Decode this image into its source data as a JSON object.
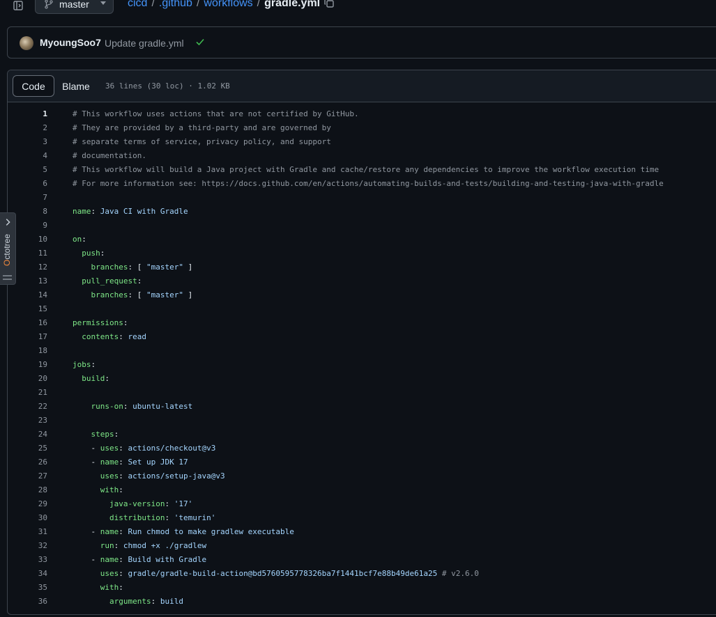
{
  "topbar": {
    "branch": "master",
    "breadcrumb": {
      "repo": "cicd",
      "dir1": ".github",
      "dir2": "workflows",
      "file": "gradle.yml",
      "separator": "/"
    }
  },
  "commit": {
    "author": "MyoungSoo7",
    "message": "Update gradle.yml"
  },
  "file_header": {
    "tab_code": "Code",
    "tab_blame": "Blame",
    "info": "36 lines (30 loc) · 1.02 KB"
  },
  "octotree": {
    "label_o": "O",
    "label_rest": "ctotree"
  },
  "code": {
    "current_line": 1,
    "lines": [
      {
        "n": "1",
        "p": [
          {
            "t": "# This workflow uses actions that are not certified by GitHub.",
            "c": "c"
          }
        ]
      },
      {
        "n": "2",
        "p": [
          {
            "t": "# They are provided by a third-party and are governed by",
            "c": "c"
          }
        ]
      },
      {
        "n": "3",
        "p": [
          {
            "t": "# separate terms of service, privacy policy, and support",
            "c": "c"
          }
        ]
      },
      {
        "n": "4",
        "p": [
          {
            "t": "# documentation.",
            "c": "c"
          }
        ]
      },
      {
        "n": "5",
        "p": [
          {
            "t": "# This workflow will build a Java project with Gradle and cache/restore any dependencies to improve the workflow execution time",
            "c": "c"
          }
        ]
      },
      {
        "n": "6",
        "p": [
          {
            "t": "# For more information see: https://docs.github.com/en/actions/automating-builds-and-tests/building-and-testing-java-with-gradle",
            "c": "c"
          }
        ]
      },
      {
        "n": "7",
        "p": []
      },
      {
        "n": "8",
        "p": [
          {
            "t": "name",
            "c": "k"
          },
          {
            "t": ": ",
            "c": "v"
          },
          {
            "t": "Java CI with Gradle",
            "c": "s"
          }
        ]
      },
      {
        "n": "9",
        "p": []
      },
      {
        "n": "10",
        "p": [
          {
            "t": "on",
            "c": "k"
          },
          {
            "t": ":",
            "c": "v"
          }
        ]
      },
      {
        "n": "11",
        "p": [
          {
            "t": "  ",
            "c": "v"
          },
          {
            "t": "push",
            "c": "k"
          },
          {
            "t": ":",
            "c": "v"
          }
        ]
      },
      {
        "n": "12",
        "p": [
          {
            "t": "    ",
            "c": "v"
          },
          {
            "t": "branches",
            "c": "k"
          },
          {
            "t": ": [ ",
            "c": "v"
          },
          {
            "t": "\"master\"",
            "c": "s"
          },
          {
            "t": " ]",
            "c": "v"
          }
        ]
      },
      {
        "n": "13",
        "p": [
          {
            "t": "  ",
            "c": "v"
          },
          {
            "t": "pull_request",
            "c": "k"
          },
          {
            "t": ":",
            "c": "v"
          }
        ]
      },
      {
        "n": "14",
        "p": [
          {
            "t": "    ",
            "c": "v"
          },
          {
            "t": "branches",
            "c": "k"
          },
          {
            "t": ": [ ",
            "c": "v"
          },
          {
            "t": "\"master\"",
            "c": "s"
          },
          {
            "t": " ]",
            "c": "v"
          }
        ]
      },
      {
        "n": "15",
        "p": []
      },
      {
        "n": "16",
        "p": [
          {
            "t": "permissions",
            "c": "k"
          },
          {
            "t": ":",
            "c": "v"
          }
        ]
      },
      {
        "n": "17",
        "p": [
          {
            "t": "  ",
            "c": "v"
          },
          {
            "t": "contents",
            "c": "k"
          },
          {
            "t": ": ",
            "c": "v"
          },
          {
            "t": "read",
            "c": "s"
          }
        ]
      },
      {
        "n": "18",
        "p": []
      },
      {
        "n": "19",
        "p": [
          {
            "t": "jobs",
            "c": "k"
          },
          {
            "t": ":",
            "c": "v"
          }
        ]
      },
      {
        "n": "20",
        "p": [
          {
            "t": "  ",
            "c": "v"
          },
          {
            "t": "build",
            "c": "k"
          },
          {
            "t": ":",
            "c": "v"
          }
        ]
      },
      {
        "n": "21",
        "p": []
      },
      {
        "n": "22",
        "p": [
          {
            "t": "    ",
            "c": "v"
          },
          {
            "t": "runs-on",
            "c": "k"
          },
          {
            "t": ": ",
            "c": "v"
          },
          {
            "t": "ubuntu-latest",
            "c": "s"
          }
        ]
      },
      {
        "n": "23",
        "p": []
      },
      {
        "n": "24",
        "p": [
          {
            "t": "    ",
            "c": "v"
          },
          {
            "t": "steps",
            "c": "k"
          },
          {
            "t": ":",
            "c": "v"
          }
        ]
      },
      {
        "n": "25",
        "p": [
          {
            "t": "    - ",
            "c": "v"
          },
          {
            "t": "uses",
            "c": "k"
          },
          {
            "t": ": ",
            "c": "v"
          },
          {
            "t": "actions/checkout@v3",
            "c": "s"
          }
        ]
      },
      {
        "n": "26",
        "p": [
          {
            "t": "    - ",
            "c": "v"
          },
          {
            "t": "name",
            "c": "k"
          },
          {
            "t": ": ",
            "c": "v"
          },
          {
            "t": "Set up JDK 17",
            "c": "s"
          }
        ]
      },
      {
        "n": "27",
        "p": [
          {
            "t": "      ",
            "c": "v"
          },
          {
            "t": "uses",
            "c": "k"
          },
          {
            "t": ": ",
            "c": "v"
          },
          {
            "t": "actions/setup-java@v3",
            "c": "s"
          }
        ]
      },
      {
        "n": "28",
        "p": [
          {
            "t": "      ",
            "c": "v"
          },
          {
            "t": "with",
            "c": "k"
          },
          {
            "t": ":",
            "c": "v"
          }
        ]
      },
      {
        "n": "29",
        "p": [
          {
            "t": "        ",
            "c": "v"
          },
          {
            "t": "java-version",
            "c": "k"
          },
          {
            "t": ": ",
            "c": "v"
          },
          {
            "t": "'17'",
            "c": "s"
          }
        ]
      },
      {
        "n": "30",
        "p": [
          {
            "t": "        ",
            "c": "v"
          },
          {
            "t": "distribution",
            "c": "k"
          },
          {
            "t": ": ",
            "c": "v"
          },
          {
            "t": "'temurin'",
            "c": "s"
          }
        ]
      },
      {
        "n": "31",
        "p": [
          {
            "t": "    - ",
            "c": "v"
          },
          {
            "t": "name",
            "c": "k"
          },
          {
            "t": ": ",
            "c": "v"
          },
          {
            "t": "Run chmod to make gradlew executable",
            "c": "s"
          }
        ]
      },
      {
        "n": "32",
        "p": [
          {
            "t": "      ",
            "c": "v"
          },
          {
            "t": "run",
            "c": "k"
          },
          {
            "t": ": ",
            "c": "v"
          },
          {
            "t": "chmod +x ./gradlew",
            "c": "s"
          }
        ]
      },
      {
        "n": "33",
        "p": [
          {
            "t": "    - ",
            "c": "v"
          },
          {
            "t": "name",
            "c": "k"
          },
          {
            "t": ": ",
            "c": "v"
          },
          {
            "t": "Build with Gradle",
            "c": "s"
          }
        ]
      },
      {
        "n": "34",
        "p": [
          {
            "t": "      ",
            "c": "v"
          },
          {
            "t": "uses",
            "c": "k"
          },
          {
            "t": ": ",
            "c": "v"
          },
          {
            "t": "gradle/gradle-build-action@bd5760595778326ba7f1441bcf7e88b49de61a25",
            "c": "s"
          },
          {
            "t": " # v2.6.0",
            "c": "c"
          }
        ]
      },
      {
        "n": "35",
        "p": [
          {
            "t": "      ",
            "c": "v"
          },
          {
            "t": "with",
            "c": "k"
          },
          {
            "t": ":",
            "c": "v"
          }
        ]
      },
      {
        "n": "36",
        "p": [
          {
            "t": "        ",
            "c": "v"
          },
          {
            "t": "arguments",
            "c": "k"
          },
          {
            "t": ": ",
            "c": "v"
          },
          {
            "t": "build",
            "c": "s"
          }
        ]
      }
    ]
  },
  "colors": {
    "background": "#0d1117",
    "link": "#4493f8",
    "yaml_key": "#7ee787",
    "yaml_value": "#a5d6ff",
    "comment": "#9198a1",
    "success": "#3fb950"
  }
}
